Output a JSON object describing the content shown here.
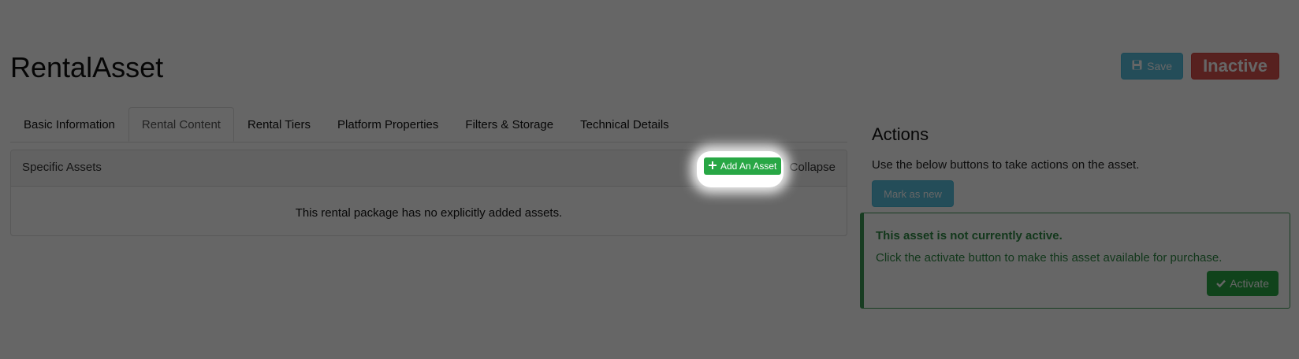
{
  "page": {
    "title": "RentalAsset"
  },
  "toolbar": {
    "save_label": "Save",
    "status_label": "Inactive"
  },
  "tabs": [
    {
      "label": "Basic Information"
    },
    {
      "label": "Rental Content"
    },
    {
      "label": "Rental Tiers"
    },
    {
      "label": "Platform Properties"
    },
    {
      "label": "Filters & Storage"
    },
    {
      "label": "Technical Details"
    }
  ],
  "assets_panel": {
    "title": "Specific Assets",
    "add_label": "Add An Asset",
    "collapse_label": "Collapse",
    "empty_text": "This rental package has no explicitly added assets."
  },
  "actions": {
    "title": "Actions",
    "description": "Use the below buttons to take actions on the asset.",
    "mark_new_label": "Mark as new"
  },
  "alert": {
    "title": "This asset is not currently active.",
    "text": "Click the activate button to make this asset available for purchase.",
    "activate_label": "Activate"
  },
  "colors": {
    "info": "#5bc0de",
    "danger": "#d9534f",
    "success": "#28a745",
    "overlay": "rgba(0,0,0,0.6)"
  }
}
